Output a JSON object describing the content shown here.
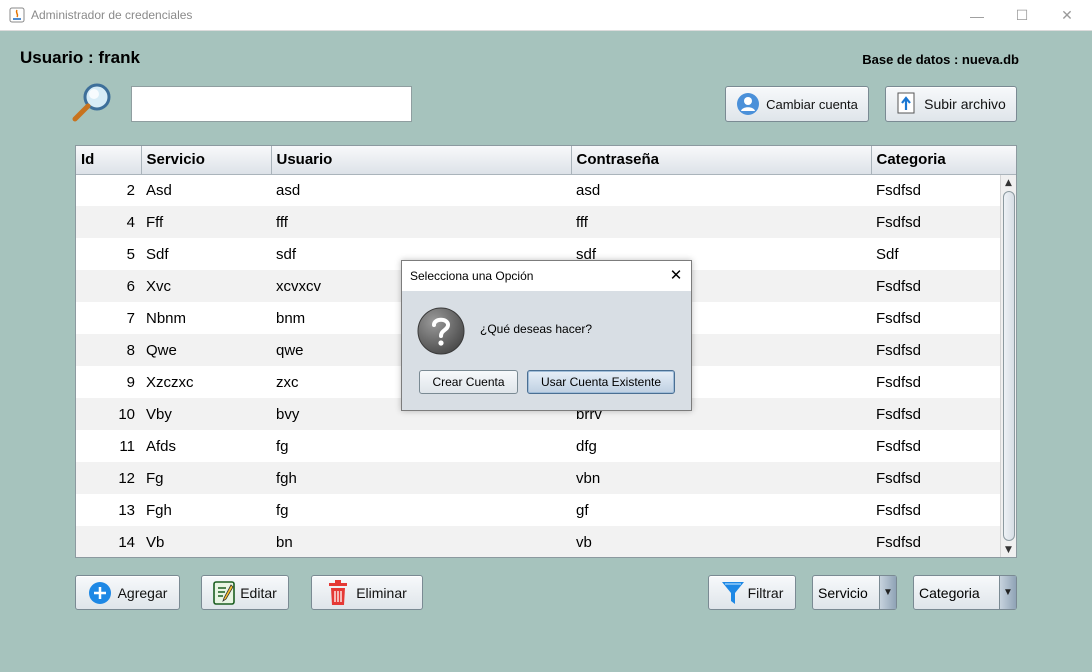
{
  "window": {
    "title": "Administrador de credenciales",
    "minimize": "—",
    "maximize": "☐",
    "close": "✕"
  },
  "header": {
    "user_label": "Usuario : frank",
    "db_label": "Base de datos : nueva.db"
  },
  "search": {
    "value": "",
    "placeholder": ""
  },
  "toolbar": {
    "change_account": "Cambiar cuenta",
    "upload_file": "Subir archivo"
  },
  "table": {
    "columns": [
      "Id",
      "Servicio",
      "Usuario",
      "Contraseña",
      "Categoria"
    ],
    "rows": [
      [
        "2",
        "Asd",
        "asd",
        "asd",
        "Fsdfsd"
      ],
      [
        "4",
        "Fff",
        "fff",
        "fff",
        "Fsdfsd"
      ],
      [
        "5",
        "Sdf",
        "sdf",
        "sdf",
        "Sdf"
      ],
      [
        "6",
        "Xvc",
        "xcvxcv",
        "",
        "Fsdfsd"
      ],
      [
        "7",
        "Nbnm",
        "bnm",
        "",
        "Fsdfsd"
      ],
      [
        "8",
        "Qwe",
        "qwe",
        "",
        "Fsdfsd"
      ],
      [
        "9",
        "Xzczxc",
        "zxc",
        "",
        "Fsdfsd"
      ],
      [
        "10",
        "Vby",
        "bvy",
        "brrv",
        "Fsdfsd"
      ],
      [
        "11",
        "Afds",
        "fg",
        "dfg",
        "Fsdfsd"
      ],
      [
        "12",
        "Fg",
        "fgh",
        "vbn",
        "Fsdfsd"
      ],
      [
        "13",
        "Fgh",
        "fg",
        "gf",
        "Fsdfsd"
      ],
      [
        "14",
        "Vb",
        "bn",
        "vb",
        "Fsdfsd"
      ]
    ]
  },
  "actions": {
    "add": "Agregar",
    "edit": "Editar",
    "delete": "Eliminar",
    "filter": "Filtrar"
  },
  "filters": {
    "service_selected": "Servicio",
    "category_selected": "Categoria"
  },
  "dialog": {
    "title": "Selecciona una Opción",
    "message": "¿Qué deseas hacer?",
    "create_button": "Crear Cuenta",
    "use_button": "Usar Cuenta Existente"
  },
  "colors": {
    "background": "#a6c3bd",
    "add_icon": "#1e88e5",
    "delete_icon": "#e53935",
    "filter_icon": "#1e88e5"
  }
}
